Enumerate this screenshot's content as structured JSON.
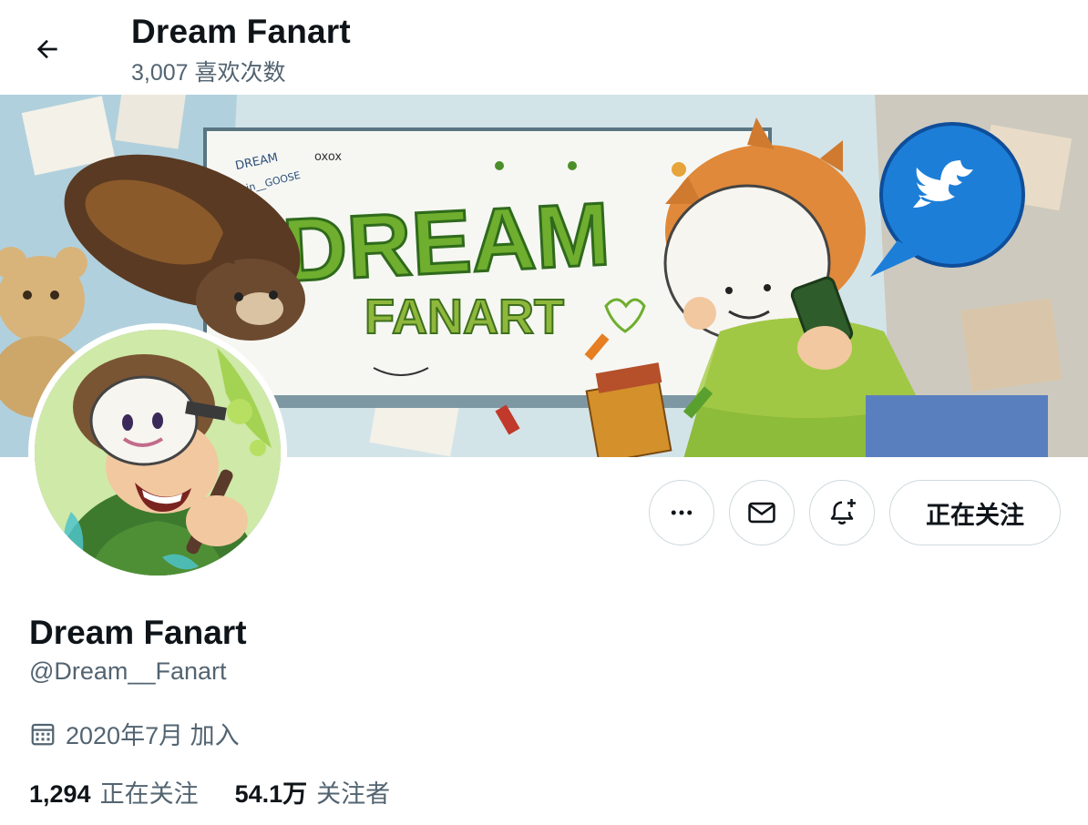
{
  "header": {
    "title": "Dream Fanart",
    "likes_count": "3,007 喜欢次数"
  },
  "banner": {
    "headline_big": "DREAM",
    "headline_small": "FANART",
    "scribble_1": "DREAM",
    "scribble_2": "stin__GOOSE",
    "scribble_3": "oxox"
  },
  "actions": {
    "follow_label": "正在关注"
  },
  "profile": {
    "display_name": "Dream Fanart",
    "handle": "@Dream__Fanart",
    "joined": "2020年7月 加入",
    "following_count": "1,294",
    "following_label": "正在关注",
    "followers_count": "54.1万",
    "followers_label": "关注者"
  },
  "icons": {
    "back": "arrow-left-icon",
    "more": "more-horizontal-icon",
    "message": "envelope-icon",
    "notify": "bell-plus-icon",
    "calendar": "calendar-icon"
  },
  "colors": {
    "text_primary": "#0f1419",
    "text_secondary": "#536471",
    "border": "#cfd9de",
    "banner_green": "#6fae2e",
    "twitter_blue": "#1d7ed8"
  }
}
